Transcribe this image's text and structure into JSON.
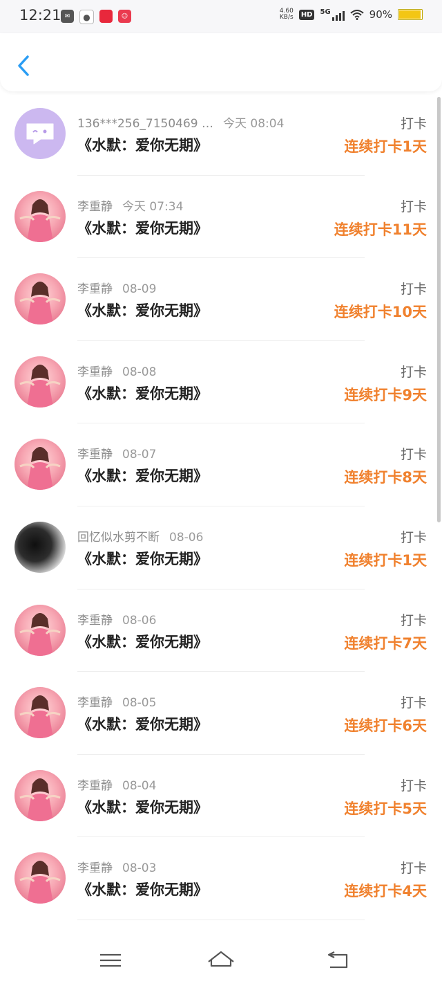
{
  "status_bar": {
    "time": "12:21",
    "net_speed_value": "4.60",
    "net_speed_unit": "KB/s",
    "hd": "HD",
    "network": "5G",
    "battery_text": "90%",
    "battery_level": 0.9
  },
  "notification_icons": [
    "mail-icon",
    "wechat-icon",
    "app-red-icon",
    "app-pink-icon"
  ],
  "header": {
    "back_icon": "chevron-left-icon"
  },
  "rows": [
    {
      "name": "136***256_7150469 …",
      "time": "今天 08:04",
      "title": "《水默：爱你无期》",
      "tag": "打卡",
      "streak": "连续打卡1天",
      "avatar": "bot"
    },
    {
      "name": "李重静",
      "time": "今天 07:34",
      "title": "《水默：爱你无期》",
      "tag": "打卡",
      "streak": "连续打卡11天",
      "avatar": "girl"
    },
    {
      "name": "李重静",
      "time": "08-09",
      "title": "《水默：爱你无期》",
      "tag": "打卡",
      "streak": "连续打卡10天",
      "avatar": "girl"
    },
    {
      "name": "李重静",
      "time": "08-08",
      "title": "《水默：爱你无期》",
      "tag": "打卡",
      "streak": "连续打卡9天",
      "avatar": "girl"
    },
    {
      "name": "李重静",
      "time": "08-07",
      "title": "《水默：爱你无期》",
      "tag": "打卡",
      "streak": "连续打卡8天",
      "avatar": "girl"
    },
    {
      "name": "回忆似水剪不断",
      "time": "08-06",
      "title": "《水默：爱你无期》",
      "tag": "打卡",
      "streak": "连续打卡1天",
      "avatar": "dark"
    },
    {
      "name": "李重静",
      "time": "08-06",
      "title": "《水默：爱你无期》",
      "tag": "打卡",
      "streak": "连续打卡7天",
      "avatar": "girl"
    },
    {
      "name": "李重静",
      "time": "08-05",
      "title": "《水默：爱你无期》",
      "tag": "打卡",
      "streak": "连续打卡6天",
      "avatar": "girl"
    },
    {
      "name": "李重静",
      "time": "08-04",
      "title": "《水默：爱你无期》",
      "tag": "打卡",
      "streak": "连续打卡5天",
      "avatar": "girl"
    },
    {
      "name": "李重静",
      "time": "08-03",
      "title": "《水默：爱你无期》",
      "tag": "打卡",
      "streak": "连续打卡4天",
      "avatar": "girl"
    }
  ],
  "nav_bar": {
    "icons": [
      "menu-icon",
      "home-icon",
      "back-icon"
    ]
  },
  "colors": {
    "accent": "#f0812e",
    "back_icon": "#2a9df4",
    "bot_avatar": "#ccb8f0"
  }
}
